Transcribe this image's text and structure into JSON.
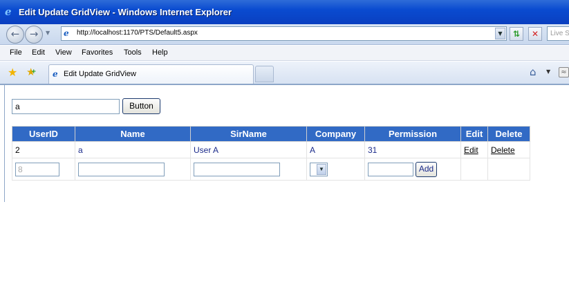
{
  "window": {
    "title": "Edit Update GridView - Windows Internet Explorer"
  },
  "addressbar": {
    "url": "http://localhost:1170/PTS/Default5.aspx",
    "search_placeholder": "Live Search"
  },
  "menu": [
    "File",
    "Edit",
    "View",
    "Favorites",
    "Tools",
    "Help"
  ],
  "tab": {
    "label": "Edit Update GridView"
  },
  "page": {
    "search_value": "a",
    "button_label": "Button",
    "grid": {
      "columns": [
        "UserID",
        "Name",
        "SirName",
        "Company",
        "Permission",
        "Edit",
        "Delete"
      ],
      "rows": [
        {
          "userid": "2",
          "name": "a",
          "sirname": "User A",
          "company": "A",
          "permission": "31",
          "edit": "Edit",
          "delete": "Delete"
        }
      ],
      "footer": {
        "userid_value": "8",
        "add_label": "Add"
      }
    }
  },
  "colors": {
    "grid_header": "#316ac5",
    "titlebar": "#0a4bd0"
  }
}
